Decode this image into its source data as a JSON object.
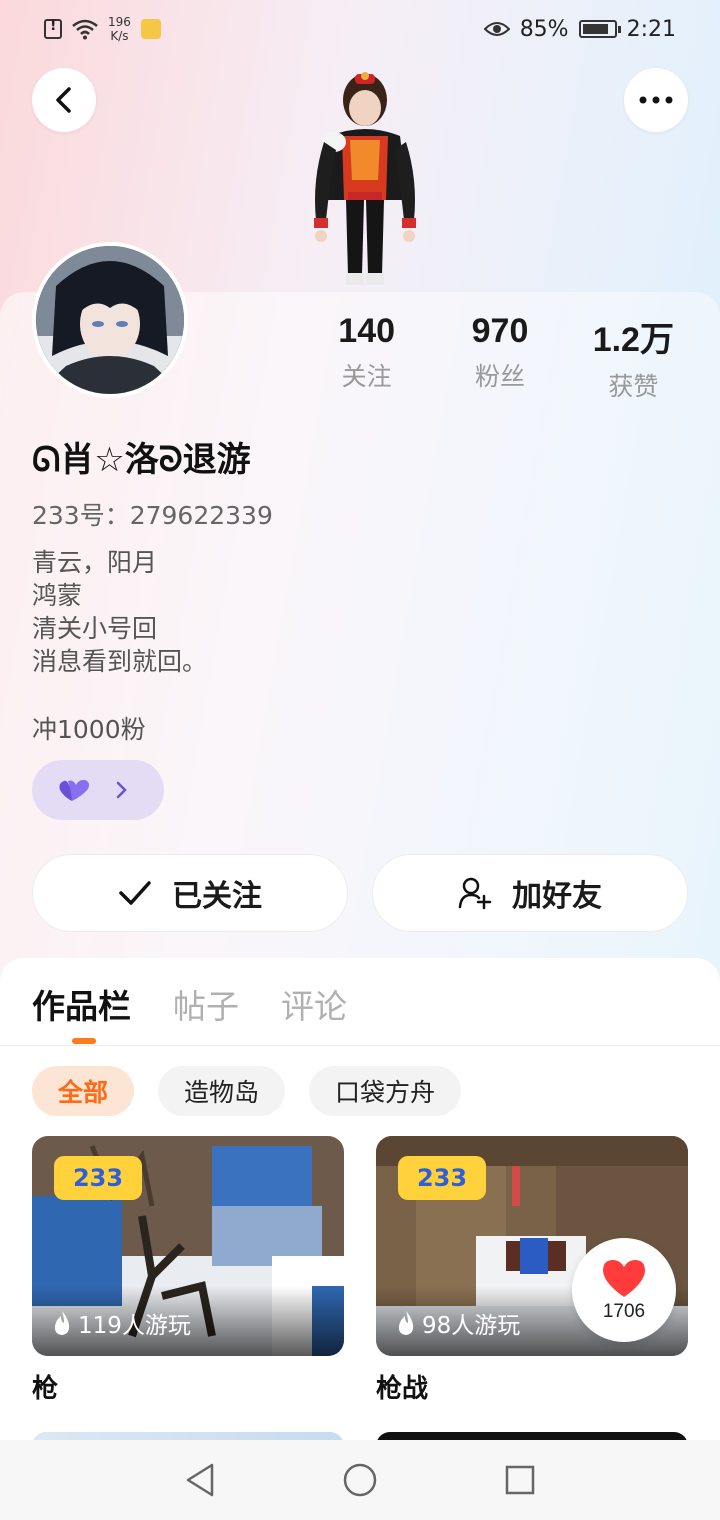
{
  "status_bar": {
    "speed_value": "196",
    "speed_unit": "K/s",
    "battery": "85%",
    "battery_level": 0.85,
    "time": "2:21"
  },
  "profile": {
    "nickname": "ᘏ肖☆洛ᘐ退游",
    "uid": "233号：279622339",
    "bio_lines": [
      "青云，阳月",
      "鸿蒙",
      "清关小号回",
      "消息看到就回。"
    ],
    "bio_extra": "冲1000粉"
  },
  "stats": [
    {
      "value": "140",
      "label": "关注"
    },
    {
      "value": "970",
      "label": "粉丝"
    },
    {
      "value": "1.2万",
      "label": "获赞"
    }
  ],
  "actions": {
    "followed_label": "已关注",
    "add_friend_label": "加好友"
  },
  "tabs": [
    "作品栏",
    "帖子",
    "评论"
  ],
  "filters": [
    "全部",
    "造物岛",
    "口袋方舟"
  ],
  "games": [
    {
      "title": "枪",
      "plays": "119人游玩",
      "logo_text": "233"
    },
    {
      "title": "枪战",
      "plays": "98人游玩",
      "logo_text": "233"
    }
  ],
  "like_count": "1706",
  "colors": {
    "accent": "#ff7a1a",
    "badge_bg": "#e4dcf5",
    "badge_heart": "#6a4fd8",
    "like_heart": "#ff3b3b"
  },
  "icons": [
    "back-icon",
    "more-icon",
    "check-icon",
    "add-friend-icon",
    "flame-icon",
    "heart-icon",
    "nav-back-icon",
    "nav-home-icon",
    "nav-recent-icon"
  ]
}
